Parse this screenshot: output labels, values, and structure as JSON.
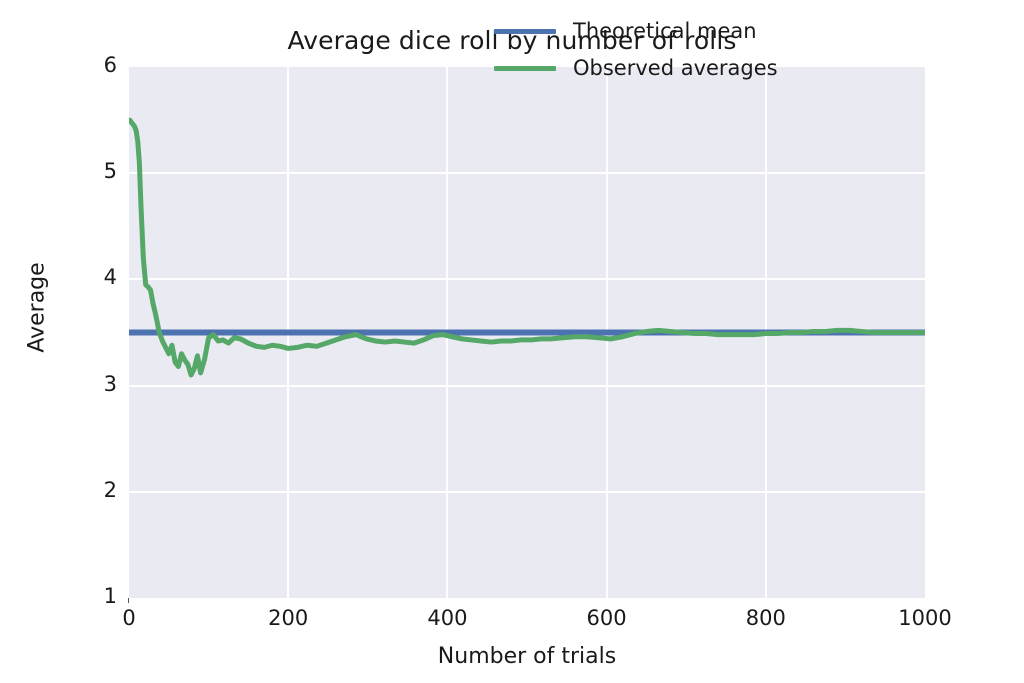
{
  "chart_data": {
    "type": "line",
    "title": "Average dice roll by number of rolls",
    "xlabel": "Number of trials",
    "ylabel": "Average",
    "xlim": [
      0,
      1000
    ],
    "ylim": [
      1,
      6
    ],
    "xticks": [
      "0",
      "200",
      "400",
      "600",
      "800",
      "1000"
    ],
    "xtick_values": [
      0,
      200,
      400,
      600,
      800,
      1000
    ],
    "yticks": [
      "1",
      "2",
      "3",
      "4",
      "5",
      "6"
    ],
    "ytick_values": [
      1,
      2,
      3,
      4,
      5,
      6
    ],
    "grid": true,
    "legend_position": "upper right",
    "background_color": "#EAEAF2",
    "series": [
      {
        "name": "Theoretical mean",
        "color": "#4C72B0",
        "type": "horizontal-line",
        "value": 3.5,
        "x": [
          0,
          1000
        ],
        "values": [
          3.5,
          3.5
        ]
      },
      {
        "name": "Observed averages",
        "color": "#55A868",
        "type": "line",
        "x": [
          1,
          3,
          5,
          7,
          9,
          11,
          13,
          15,
          18,
          21,
          24,
          27,
          30,
          34,
          38,
          42,
          46,
          50,
          54,
          58,
          62,
          66,
          70,
          74,
          78,
          82,
          86,
          90,
          95,
          100,
          106,
          112,
          118,
          125,
          132,
          140,
          150,
          160,
          170,
          180,
          190,
          200,
          212,
          224,
          236,
          248,
          260,
          272,
          285,
          298,
          310,
          322,
          334,
          346,
          358,
          370,
          382,
          394,
          406,
          418,
          430,
          442,
          455,
          468,
          480,
          492,
          505,
          518,
          530,
          545,
          560,
          575,
          590,
          605,
          620,
          635,
          650,
          665,
          680,
          695,
          710,
          725,
          740,
          755,
          770,
          785,
          800,
          815,
          830,
          845,
          860,
          875,
          890,
          905,
          920,
          935,
          950,
          965,
          980,
          1000
        ],
        "values": [
          5.5,
          5.48,
          5.46,
          5.44,
          5.4,
          5.3,
          5.1,
          4.7,
          4.2,
          3.95,
          3.93,
          3.9,
          3.78,
          3.65,
          3.5,
          3.42,
          3.36,
          3.3,
          3.38,
          3.22,
          3.18,
          3.3,
          3.24,
          3.2,
          3.1,
          3.16,
          3.28,
          3.12,
          3.25,
          3.45,
          3.48,
          3.42,
          3.43,
          3.4,
          3.45,
          3.44,
          3.4,
          3.37,
          3.36,
          3.38,
          3.37,
          3.35,
          3.36,
          3.38,
          3.37,
          3.4,
          3.43,
          3.46,
          3.48,
          3.44,
          3.42,
          3.41,
          3.42,
          3.41,
          3.4,
          3.43,
          3.47,
          3.48,
          3.46,
          3.44,
          3.43,
          3.42,
          3.41,
          3.42,
          3.42,
          3.43,
          3.43,
          3.44,
          3.44,
          3.45,
          3.46,
          3.46,
          3.45,
          3.44,
          3.46,
          3.49,
          3.51,
          3.52,
          3.51,
          3.5,
          3.49,
          3.49,
          3.48,
          3.48,
          3.48,
          3.48,
          3.49,
          3.49,
          3.5,
          3.5,
          3.51,
          3.51,
          3.52,
          3.52,
          3.51,
          3.5,
          3.5,
          3.5,
          3.5,
          3.5
        ]
      }
    ]
  },
  "legend": {
    "items": [
      {
        "label": "Theoretical mean",
        "color": "#4C72B0"
      },
      {
        "label": "Observed averages",
        "color": "#55A868"
      }
    ]
  }
}
